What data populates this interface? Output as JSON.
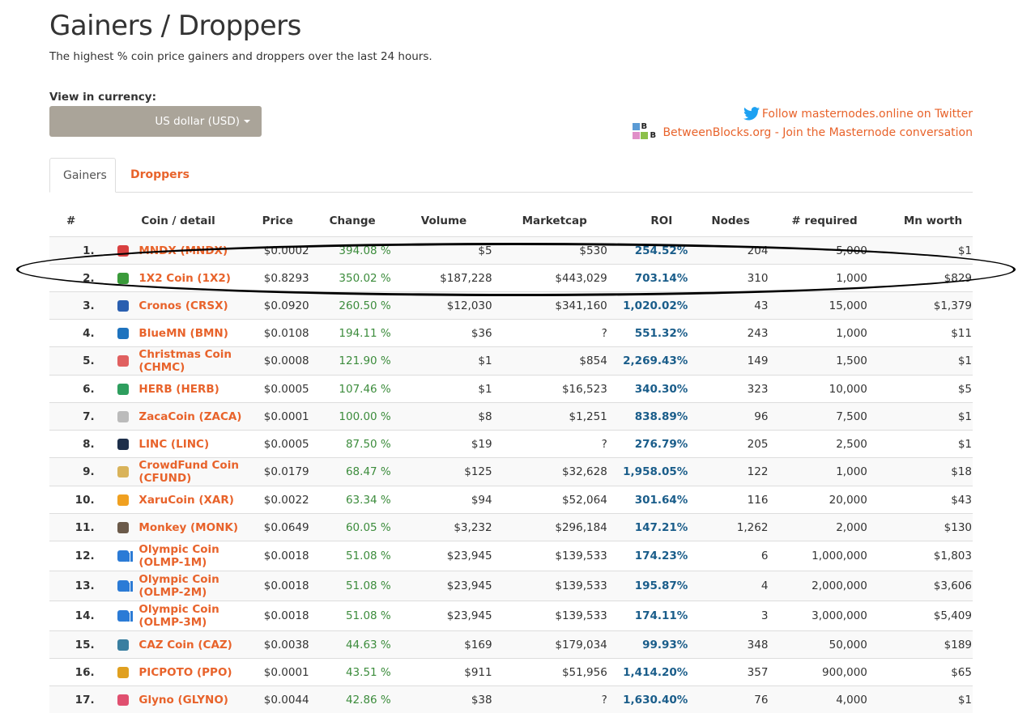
{
  "page": {
    "title": "Gainers / Droppers",
    "subtitle": "The highest % coin price gainers and droppers over the last 24 hours."
  },
  "currency": {
    "label": "View in currency:",
    "selected": "US dollar (USD)"
  },
  "links": {
    "twitter": "Follow masternodes.online on Twitter",
    "betweenblocks": "BetweenBlocks.org - Join the Masternode conversation",
    "bb_letter": "B"
  },
  "tabs": [
    {
      "label": "Gainers",
      "active": true
    },
    {
      "label": "Droppers",
      "active": false
    }
  ],
  "table": {
    "headers": [
      "#",
      "Coin / detail",
      "Price",
      "Change",
      "Volume",
      "Marketcap",
      "ROI",
      "Nodes",
      "# required",
      "Mn worth"
    ],
    "rows": [
      {
        "num": "1.",
        "coin": "MNDX (MNDX)",
        "price": "$0.0002",
        "change": "394.08 %",
        "volume": "$5",
        "mcap": "$530",
        "roi": "254.52%",
        "nodes": "204",
        "required": "5,000",
        "worth": "$1",
        "icon": "mndx-icon",
        "icon_color": "#d94040",
        "bars": false
      },
      {
        "num": "2.",
        "coin": "1X2 Coin (1X2)",
        "price": "$0.8293",
        "change": "350.02 %",
        "volume": "$187,228",
        "mcap": "$443,029",
        "roi": "703.14%",
        "nodes": "310",
        "required": "1,000",
        "worth": "$829",
        "icon": "1x2-icon",
        "icon_color": "#3a9a3a",
        "bars": false
      },
      {
        "num": "3.",
        "coin": "Cronos (CRSX)",
        "price": "$0.0920",
        "change": "260.50 %",
        "volume": "$12,030",
        "mcap": "$341,160",
        "roi": "1,020.02%",
        "nodes": "43",
        "required": "15,000",
        "worth": "$1,379",
        "icon": "cronos-icon",
        "icon_color": "#2a5fb0",
        "bars": false
      },
      {
        "num": "4.",
        "coin": "BlueMN (BMN)",
        "price": "$0.0108",
        "change": "194.11 %",
        "volume": "$36",
        "mcap": "?",
        "roi": "551.32%",
        "nodes": "243",
        "required": "1,000",
        "worth": "$11",
        "icon": "bluemn-icon",
        "icon_color": "#1e73be",
        "bars": false
      },
      {
        "num": "5.",
        "coin": "Christmas Coin (CHMC)",
        "price": "$0.0008",
        "change": "121.90 %",
        "volume": "$1",
        "mcap": "$854",
        "roi": "2,269.43%",
        "nodes": "149",
        "required": "1,500",
        "worth": "$1",
        "icon": "christmas-icon",
        "icon_color": "#e06060",
        "bars": false
      },
      {
        "num": "6.",
        "coin": "HERB (HERB)",
        "price": "$0.0005",
        "change": "107.46 %",
        "volume": "$1",
        "mcap": "$16,523",
        "roi": "340.30%",
        "nodes": "323",
        "required": "10,000",
        "worth": "$5",
        "icon": "herb-icon",
        "icon_color": "#2e9e5e",
        "bars": false
      },
      {
        "num": "7.",
        "coin": "ZacaCoin (ZACA)",
        "price": "$0.0001",
        "change": "100.00 %",
        "volume": "$8",
        "mcap": "$1,251",
        "roi": "838.89%",
        "nodes": "96",
        "required": "7,500",
        "worth": "$1",
        "icon": "zaca-icon",
        "icon_color": "#bbbbbb",
        "bars": false
      },
      {
        "num": "8.",
        "coin": "LINC (LINC)",
        "price": "$0.0005",
        "change": "87.50 %",
        "volume": "$19",
        "mcap": "?",
        "roi": "276.79%",
        "nodes": "205",
        "required": "2,500",
        "worth": "$1",
        "icon": "linc-icon",
        "icon_color": "#1d2f4a",
        "bars": false
      },
      {
        "num": "9.",
        "coin": "CrowdFund Coin (CFUND)",
        "price": "$0.0179",
        "change": "68.47 %",
        "volume": "$125",
        "mcap": "$32,628",
        "roi": "1,958.05%",
        "nodes": "122",
        "required": "1,000",
        "worth": "$18",
        "icon": "cfund-icon",
        "icon_color": "#d9b35a",
        "bars": false
      },
      {
        "num": "10.",
        "coin": "XaruCoin (XAR)",
        "price": "$0.0022",
        "change": "63.34 %",
        "volume": "$94",
        "mcap": "$52,064",
        "roi": "301.64%",
        "nodes": "116",
        "required": "20,000",
        "worth": "$43",
        "icon": "xaru-icon",
        "icon_color": "#f0a020",
        "bars": false
      },
      {
        "num": "11.",
        "coin": "Monkey (MONK)",
        "price": "$0.0649",
        "change": "60.05 %",
        "volume": "$3,232",
        "mcap": "$296,184",
        "roi": "147.21%",
        "nodes": "1,262",
        "required": "2,000",
        "worth": "$130",
        "icon": "monkey-icon",
        "icon_color": "#6b5a4a",
        "bars": false
      },
      {
        "num": "12.",
        "coin": "Olympic Coin (OLMP-1M)",
        "price": "$0.0018",
        "change": "51.08 %",
        "volume": "$23,945",
        "mcap": "$139,533",
        "roi": "174.23%",
        "nodes": "6",
        "required": "1,000,000",
        "worth": "$1,803",
        "icon": "olympic-icon",
        "icon_color": "#2b7bd6",
        "bars": true
      },
      {
        "num": "13.",
        "coin": "Olympic Coin (OLMP-2M)",
        "price": "$0.0018",
        "change": "51.08 %",
        "volume": "$23,945",
        "mcap": "$139,533",
        "roi": "195.87%",
        "nodes": "4",
        "required": "2,000,000",
        "worth": "$3,606",
        "icon": "olympic-icon",
        "icon_color": "#2b7bd6",
        "bars": true
      },
      {
        "num": "14.",
        "coin": "Olympic Coin (OLMP-3M)",
        "price": "$0.0018",
        "change": "51.08 %",
        "volume": "$23,945",
        "mcap": "$139,533",
        "roi": "174.11%",
        "nodes": "3",
        "required": "3,000,000",
        "worth": "$5,409",
        "icon": "olympic-icon",
        "icon_color": "#2b7bd6",
        "bars": true
      },
      {
        "num": "15.",
        "coin": "CAZ Coin (CAZ)",
        "price": "$0.0038",
        "change": "44.63 %",
        "volume": "$169",
        "mcap": "$179,034",
        "roi": "99.93%",
        "nodes": "348",
        "required": "50,000",
        "worth": "$189",
        "icon": "caz-icon",
        "icon_color": "#3a7fa0",
        "bars": false
      },
      {
        "num": "16.",
        "coin": "PICPOTO (PPO)",
        "price": "$0.0001",
        "change": "43.51 %",
        "volume": "$911",
        "mcap": "$51,956",
        "roi": "1,414.20%",
        "nodes": "357",
        "required": "900,000",
        "worth": "$65",
        "icon": "picpoto-icon",
        "icon_color": "#e0a020",
        "bars": false
      },
      {
        "num": "17.",
        "coin": "Glyno (GLYNO)",
        "price": "$0.0044",
        "change": "42.86 %",
        "volume": "$38",
        "mcap": "?",
        "roi": "1,630.40%",
        "nodes": "76",
        "required": "4,000",
        "worth": "$1",
        "icon": "glyno-icon",
        "icon_color": "#e05070",
        "bars": false
      }
    ]
  },
  "colors": {
    "accent": "#e8632b",
    "change_green": "#3c8c3c",
    "roi_blue": "#1a5d8a",
    "currency_button": "#aaa499",
    "twitter_blue": "#1da1f2"
  }
}
